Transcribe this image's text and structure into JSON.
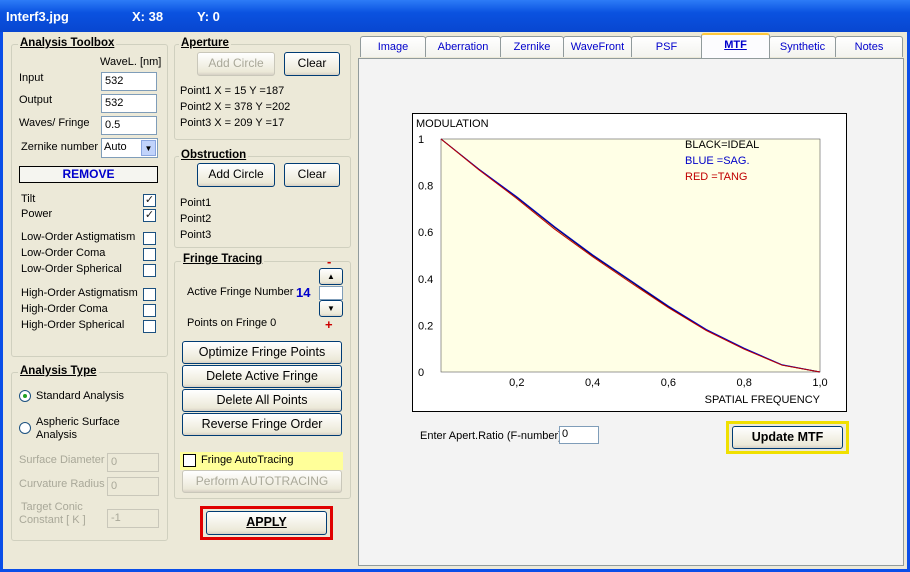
{
  "titlebar": {
    "filename": "Interf3.jpg",
    "x_label": "X: 38",
    "y_label": "Y: 0"
  },
  "toolbox": {
    "title": "Analysis Toolbox",
    "wavel_header": "WaveL. [nm]",
    "input_label": "Input",
    "input_value": "532",
    "output_label": "Output",
    "output_value": "532",
    "waves_label": "Waves/ Fringe",
    "waves_value": "0.5",
    "zernike_label": "Zernike number",
    "zernike_value": "Auto",
    "remove_label": "REMOVE",
    "terms": [
      {
        "label": "Tilt",
        "checked": true
      },
      {
        "label": "Power",
        "checked": true
      },
      {
        "label": "Low-Order  Astigmatism",
        "checked": false
      },
      {
        "label": "Low-Order  Coma",
        "checked": false
      },
      {
        "label": "Low-Order  Spherical",
        "checked": false
      },
      {
        "label": "High-Order  Astigmatism",
        "checked": false
      },
      {
        "label": "High-Order  Coma",
        "checked": false
      },
      {
        "label": "High-Order  Spherical",
        "checked": false
      }
    ]
  },
  "analysis_type": {
    "title": "Analysis Type",
    "standard": "Standard Analysis",
    "aspheric_line1": "Aspheric  Surface",
    "aspheric_line2": "Analysis",
    "surface_diameter_label": "Surface Diameter",
    "surface_diameter_value": "0",
    "curvature_radius_label": "Curvature Radius",
    "curvature_radius_value": "0",
    "conic_label_1": "Target Conic",
    "conic_label_2": "Constant [ K ]",
    "conic_value": "-1"
  },
  "aperture": {
    "title": "Aperture",
    "add_circle": "Add Circle",
    "clear": "Clear",
    "p1": "Point1  X =   15   Y =187",
    "p2": "Point2  X =   378   Y =202",
    "p3": "Point3  X =   209   Y =17"
  },
  "obstruction": {
    "title": "Obstruction",
    "add_circle": "Add Circle",
    "clear": "Clear",
    "p1": "Point1",
    "p2": "Point2",
    "p3": "Point3"
  },
  "fringe": {
    "title": "Fringe Tracing",
    "minus": "-",
    "plus": "+",
    "active_label": "Active Fringe Number",
    "active_value": "14",
    "points_label": "Points on  Fringe 0",
    "optimize": "Optimize Fringe Points",
    "delete_active": "Delete Active Fringe",
    "delete_all": "Delete  All  Points",
    "reverse": "Reverse  Fringe Order",
    "autotracing": "Fringe AutoTracing",
    "perform": "Perform  AUTOTRACING"
  },
  "apply_label": "APPLY",
  "tabs": [
    "Image",
    "Aberration",
    "Zernike",
    "WaveFront",
    "PSF",
    "MTF",
    "Synthetic",
    "Notes"
  ],
  "active_tab": "MTF",
  "mtf": {
    "aperture_ratio_label": "Enter Apert.Ratio (F-number)",
    "aperture_ratio_value": "0",
    "update_label": "Update MTF",
    "colors": {
      "ideal": "#000000",
      "sag": "#0000c8",
      "tang": "#c00000",
      "plot_bg": "#ffffe6",
      "highlight": "#f0e000"
    }
  },
  "chart_data": {
    "type": "line",
    "ylabel": "MODULATION",
    "xlabel": "SPATIAL FREQUENCY",
    "xlim": [
      0,
      1.0
    ],
    "ylim": [
      0,
      1
    ],
    "x_ticks": [
      "0,2",
      "0,4",
      "0,6",
      "0,8",
      "1,0"
    ],
    "y_ticks": [
      "0",
      "0.2",
      "0.4",
      "0.6",
      "0.8",
      "1"
    ],
    "legend": [
      "BLACK=IDEAL",
      "BLUE   =SAG.",
      "RED     =TANG"
    ],
    "x": [
      0,
      0.1,
      0.2,
      0.3,
      0.4,
      0.5,
      0.6,
      0.7,
      0.8,
      0.9,
      1.0
    ],
    "series": [
      {
        "name": "IDEAL",
        "color": "#000000",
        "values": [
          1.0,
          0.87,
          0.75,
          0.62,
          0.5,
          0.39,
          0.28,
          0.18,
          0.1,
          0.03,
          0.0
        ]
      },
      {
        "name": "SAG.",
        "color": "#0000c8",
        "values": [
          1.0,
          0.871,
          0.752,
          0.623,
          0.503,
          0.393,
          0.283,
          0.183,
          0.102,
          0.031,
          0.0
        ]
      },
      {
        "name": "TANG",
        "color": "#c00000",
        "values": [
          1.0,
          0.868,
          0.744,
          0.613,
          0.495,
          0.384,
          0.276,
          0.178,
          0.098,
          0.029,
          0.0
        ]
      }
    ]
  }
}
